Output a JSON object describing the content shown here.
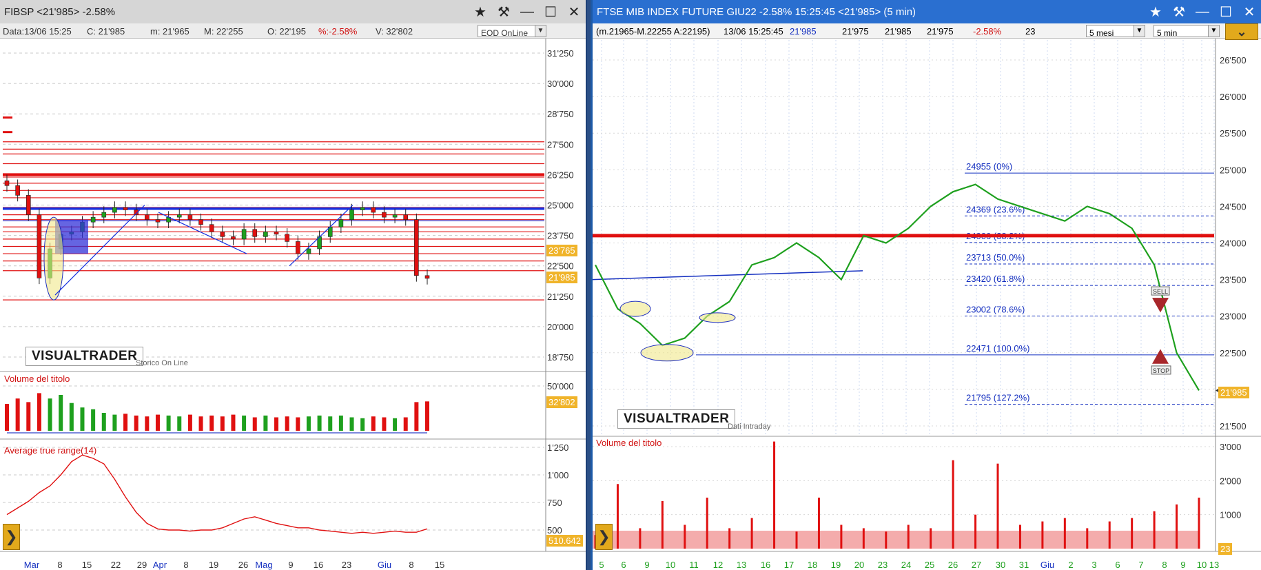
{
  "left": {
    "title": "FIBSP <21'985> -2.58%",
    "info": {
      "data": "Data:13/06 15:25",
      "close": "C: 21'985",
      "min": "m: 21'965",
      "max": "M: 22'255",
      "open": "O: 22'195",
      "pct": "%:-2.58%",
      "vol": "V: 32'802"
    },
    "source_select": "EOD OnLine",
    "logo": "VISUALTRADER",
    "logo_sub": "Storico On Line",
    "volume_label": "Volume del titolo",
    "atr_label": "Average true range(14)",
    "price_ticks": [
      "31'250",
      "30'000",
      "28'750",
      "27'500",
      "26'250",
      "25'000",
      "23'750",
      "22'500",
      "21'250",
      "20'000",
      "18'750"
    ],
    "price_tags": [
      "23'765",
      "21'985"
    ],
    "volume_ticks": [
      "50'000"
    ],
    "volume_tag": "32'802",
    "atr_ticks": [
      "1'250",
      "1'000",
      "750",
      "500"
    ],
    "atr_tag": "510.642",
    "date_labels": [
      "Mar",
      "8",
      "15",
      "22",
      "29",
      "Apr",
      "8",
      "19",
      "26",
      "Mag",
      "9",
      "16",
      "23",
      "Giu",
      "8",
      "15"
    ],
    "colors": {
      "up": "#1ea01e",
      "down": "#e01010",
      "level_line": "#e01010",
      "trend_line": "#1530e0",
      "atr": "#e01010"
    }
  },
  "right": {
    "title": "FTSE MIB INDEX FUTURE GIU22 -2.58% 15:25:45  <21'985> (5 min)",
    "info": {
      "range": "(m.21965-M.22255 A:22195)",
      "stamp": "13/06 15:25:45",
      "last": "21'985",
      "o": "21'975",
      "h": "21'985",
      "l": "21'975",
      "pct": "-2.58%",
      "vol": "23"
    },
    "period_select": "5 mesi",
    "tf_select": "5 min",
    "logo": "VISUALTRADER",
    "logo_sub": "Dati Intraday",
    "volume_label": "Volume del titolo",
    "price_ticks": [
      "26'500",
      "26'000",
      "25'500",
      "25'000",
      "24'500",
      "24'000",
      "23'500",
      "23'000",
      "22'500",
      "22'000",
      "21'500"
    ],
    "price_tag": "21'985",
    "volume_ticks": [
      "3'000",
      "2'000",
      "1'000"
    ],
    "volume_tag": "23",
    "fib_levels": [
      "24955 (0%)",
      "24369 (23.6%)",
      "24006 (38.2%)",
      "23713 (50.0%)",
      "23420 (61.8%)",
      "23002 (78.6%)",
      "22471 (100.0%)",
      "21795 (127.2%)"
    ],
    "signals": {
      "sell": "SELL",
      "stop": "STOP"
    },
    "date_labels": [
      "5",
      "6",
      "9",
      "10",
      "11",
      "12",
      "13",
      "16",
      "17",
      "18",
      "19",
      "20",
      "23",
      "24",
      "25",
      "26",
      "27",
      "30",
      "31",
      "Giu",
      "2",
      "3",
      "6",
      "7",
      "8",
      "9",
      "10",
      "13"
    ],
    "colors": {
      "fib": "#1530c0",
      "resistance": "#e01010",
      "up": "#1ea01e",
      "down": "#e01010"
    }
  },
  "chart_data": [
    {
      "type": "candlestick",
      "title": "FIBSP <21'985> -2.58%",
      "x_categories": [
        "Mar",
        "8",
        "15",
        "22",
        "29",
        "Apr",
        "8",
        "19",
        "26",
        "Mag",
        "9",
        "16",
        "23",
        "Giu",
        "8",
        "15"
      ],
      "ylim": [
        18000,
        32000
      ],
      "close_series": [
        25800,
        25400,
        24600,
        22000,
        23200,
        23800,
        23900,
        24300,
        24500,
        24700,
        24900,
        24800,
        24600,
        24400,
        24300,
        24500,
        24600,
        24400,
        24200,
        23900,
        23700,
        23600,
        24000,
        23700,
        23900,
        23800,
        23500,
        23000,
        23200,
        23700,
        24100,
        24400,
        24800,
        24900,
        24700,
        24500,
        24600,
        24400,
        22100,
        21985
      ],
      "last": 21985,
      "volume_series": [
        30000,
        36000,
        32000,
        42000,
        36000,
        40000,
        31000,
        26000,
        24000,
        20000,
        18000,
        19000,
        17000,
        16000,
        18000,
        17000,
        16000,
        18000,
        16000,
        17000,
        16000,
        18000,
        17000,
        15000,
        17000,
        15000,
        16000,
        15000,
        16000,
        17000,
        16000,
        17000,
        15000,
        14000,
        16000,
        15000,
        14000,
        15000,
        32000,
        32802
      ],
      "atr_series": [
        640,
        700,
        760,
        840,
        900,
        1000,
        1120,
        1180,
        1150,
        1100,
        960,
        800,
        660,
        560,
        510,
        500,
        500,
        490,
        500,
        500,
        520,
        560,
        600,
        620,
        590,
        560,
        540,
        520,
        520,
        500,
        490,
        480,
        470,
        480,
        470,
        480,
        490,
        480,
        480,
        510.642
      ],
      "atr_last": 510.642
    },
    {
      "type": "line",
      "title": "FTSE MIB INDEX FUTURE GIU22 -2.58% 15:25:45  <21'985> (5 min)",
      "x_categories": [
        "5",
        "6",
        "9",
        "10",
        "11",
        "12",
        "13",
        "16",
        "17",
        "18",
        "19",
        "20",
        "23",
        "24",
        "25",
        "26",
        "27",
        "30",
        "31",
        "Giu",
        "2",
        "3",
        "6",
        "7",
        "8",
        "9",
        "10",
        "13"
      ],
      "ylim": [
        21500,
        26750
      ],
      "values": [
        23700,
        23100,
        22900,
        22600,
        22700,
        23000,
        23200,
        23700,
        23800,
        24000,
        23800,
        23500,
        24100,
        24000,
        24200,
        24500,
        24700,
        24800,
        24600,
        24500,
        24400,
        24300,
        24500,
        24400,
        24200,
        23700,
        22500,
        21985
      ],
      "fib_levels": [
        24955,
        24369,
        24006,
        23713,
        23420,
        23002,
        22471,
        21795
      ],
      "resistance": 24100,
      "last": 21985,
      "volume_series": [
        400,
        1900,
        600,
        1400,
        700,
        1500,
        600,
        900,
        3150,
        500,
        1500,
        700,
        600,
        500,
        700,
        600,
        2600,
        1000,
        2500,
        700,
        800,
        900,
        600,
        800,
        900,
        1100,
        1300,
        1500
      ]
    }
  ]
}
